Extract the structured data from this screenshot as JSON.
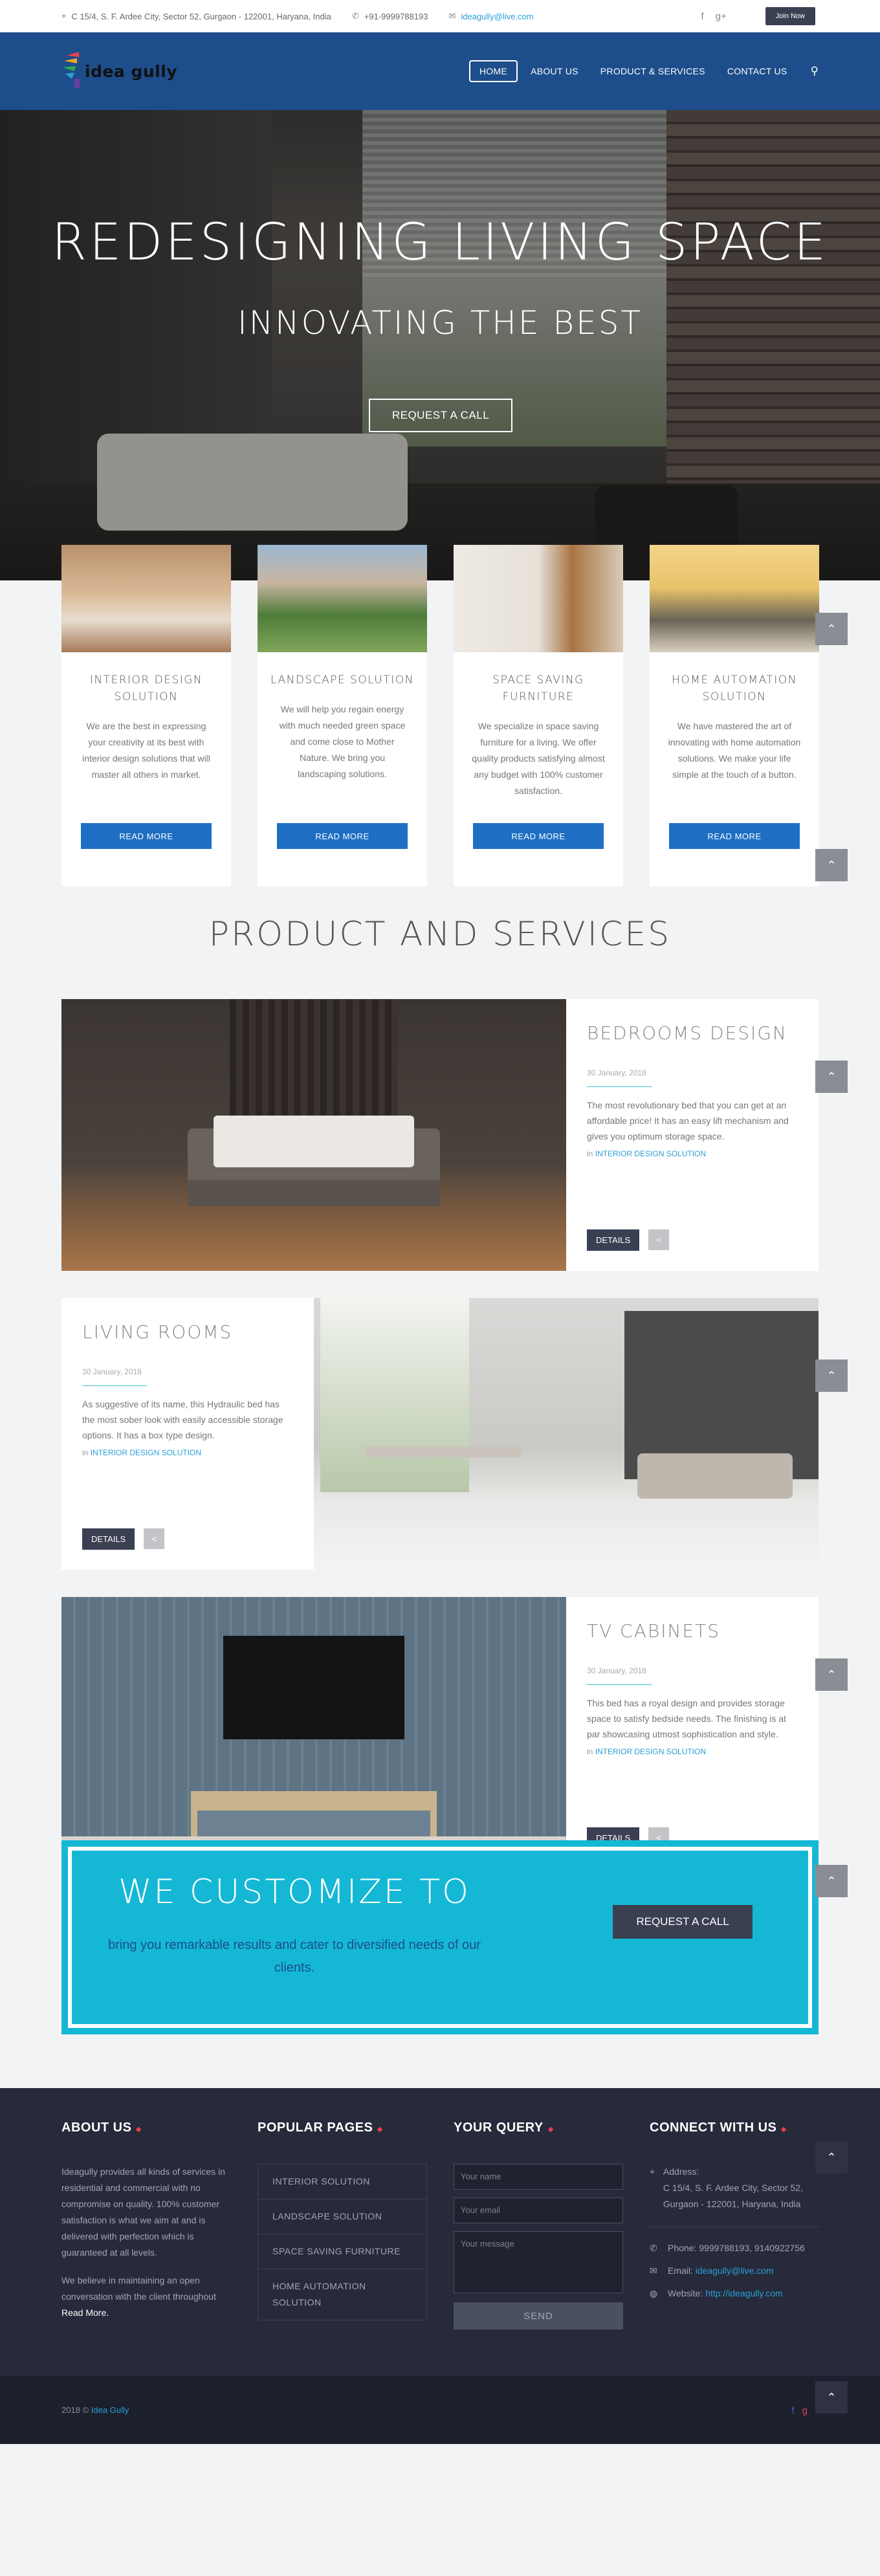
{
  "topbar": {
    "address": "C 15/4, S. F. Ardee City, Sector 52, Gurgaon - 122001, Haryana, India",
    "phone": "+91-9999788193",
    "email": "ideagully@live.com",
    "join_label": "Join Now"
  },
  "header": {
    "logo_text": "idea gully",
    "nav": [
      "HOME",
      "ABOUT US",
      "PRODUCT & SERVICES",
      "CONTACT US"
    ]
  },
  "hero": {
    "title": "REDESIGNING LIVING SPACE",
    "subtitle": "INNOVATING THE BEST",
    "cta": "REQUEST A CALL"
  },
  "services": [
    {
      "title": "INTERIOR DESIGN SOLUTION",
      "desc": "We are the best in expressing your creativity at its best with interior design solutions that will master all others in market.",
      "button": "READ MORE"
    },
    {
      "title": "LANDSCAPE SOLUTION",
      "desc": "We will help you regain energy with much needed green space and come close to Mother Nature. We bring you landscaping solutions.",
      "button": "READ MORE"
    },
    {
      "title": "SPACE SAVING FURNITURE",
      "desc": "We specialize in space saving furniture for a living. We offer quality products satisfying almost any budget with 100% customer satisfaction.",
      "button": "READ MORE"
    },
    {
      "title": "HOME AUTOMATION SOLUTION",
      "desc": "We have mastered the art of innovating with home automation solutions. We make your life simple at the touch of a button.",
      "button": "READ MORE"
    }
  ],
  "products_title": "PRODUCT AND SERVICES",
  "products": [
    {
      "title": "BEDROOMS DESIGN",
      "date": "30 January, 2018",
      "desc": "The most revolutionary bed that you can get at an affordable price! It has an easy lift mechanism and gives you optimum storage space.",
      "cat_prefix": "in",
      "category": "INTERIOR DESIGN SOLUTION",
      "details": "DETAILS"
    },
    {
      "title": "LIVING ROOMS",
      "date": "30 January, 2018",
      "desc": "As suggestive of its name, this Hydraulic bed has the most sober look with easily accessible storage options. It has a box type design.",
      "cat_prefix": "in",
      "category": "INTERIOR DESIGN SOLUTION",
      "details": "DETAILS"
    },
    {
      "title": "TV CABINETS",
      "date": "30 January, 2018",
      "desc": "This bed has a royal design and provides storage space to satisfy bedside needs. The finishing is at par showcasing utmost sophistication and style.",
      "cat_prefix": "in",
      "category": "INTERIOR DESIGN SOLUTION",
      "details": "DETAILS"
    }
  ],
  "customize": {
    "title": "WE CUSTOMIZE TO",
    "text": "bring you remarkable results and cater to diversified needs of our clients.",
    "button": "REQUEST A CALL"
  },
  "footer": {
    "about_title": "ABOUT US",
    "about_p1": "Ideagully provides all kinds of services in residential and commercial with no compromise on quality. 100% customer satisfaction is what we aim at and is delivered with perfection which is guaranteed at all levels.",
    "about_p2": "We believe in maintaining an open conversation with the client throughout",
    "about_more": "Read More.",
    "pages_title": "POPULAR PAGES",
    "pages": [
      "INTERIOR SOLUTION",
      "LANDSCAPE SOLUTION",
      "SPACE SAVING FURNITURE",
      "HOME AUTOMATION SOLUTION"
    ],
    "query_title": "YOUR QUERY",
    "name_ph": "Your name",
    "email_ph": "Your email",
    "message_ph": "Your message",
    "send": "SEND",
    "connect_title": "CONNECT WITH US",
    "address_label": "Address:",
    "address": "C 15/4, S. F. Ardee City, Sector 52, Gurgaon - 122001, Haryana, India",
    "phone": "Phone: 9999788193, 9140922756",
    "email_label": "Email:",
    "email": "ideagully@live.com",
    "website_label": "Website:",
    "website": "http://ideagully.com",
    "copy_year": "2018 ©",
    "copy_name": "Idea Gully"
  },
  "colors": {
    "header": "#1d4d8a",
    "accent": "#1e6fc3",
    "cyan": "#14b8d5",
    "dark": "#262a3a"
  }
}
